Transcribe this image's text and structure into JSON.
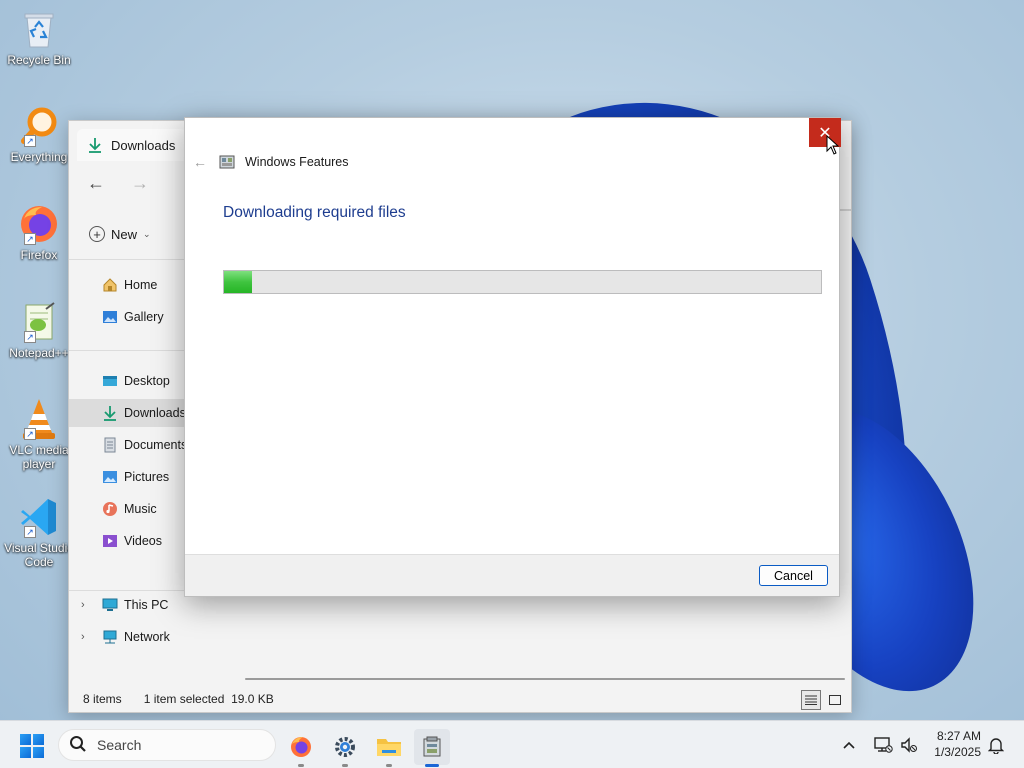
{
  "desktop": {
    "icons": [
      {
        "label": "Recycle Bin",
        "icon": "recycle-bin-icon"
      },
      {
        "label": "Everything",
        "icon": "everything-search-icon"
      },
      {
        "label": "Firefox",
        "icon": "firefox-icon"
      },
      {
        "label": "Notepad++",
        "icon": "notepad-plus-plus-icon"
      },
      {
        "label": "VLC media player",
        "icon": "vlc-icon"
      },
      {
        "label": "Visual Studio Code",
        "icon": "vscode-icon"
      }
    ]
  },
  "explorer": {
    "tab_title": "Downloads",
    "new_label": "New",
    "sidebar": [
      {
        "label": "Home",
        "icon": "home-icon"
      },
      {
        "label": "Gallery",
        "icon": "gallery-icon"
      },
      {
        "label": "Desktop",
        "icon": "desktop-folder-icon"
      },
      {
        "label": "Downloads",
        "icon": "downloads-icon",
        "selected": true
      },
      {
        "label": "Documents",
        "icon": "documents-icon"
      },
      {
        "label": "Pictures",
        "icon": "pictures-icon"
      },
      {
        "label": "Music",
        "icon": "music-icon"
      },
      {
        "label": "Videos",
        "icon": "videos-icon"
      },
      {
        "label": "This PC",
        "icon": "this-pc-icon"
      },
      {
        "label": "Network",
        "icon": "network-icon"
      }
    ],
    "status": {
      "items_count": "8 items",
      "selection": "1 item selected",
      "size": "19.0 KB"
    }
  },
  "dialog": {
    "title": "Windows Features",
    "heading": "Downloading required files",
    "progress": 0.047,
    "cancel_label": "Cancel",
    "close_symbol": "✕"
  },
  "taskbar": {
    "search_placeholder": "Search",
    "apps": [
      "firefox-icon",
      "settings-icon",
      "file-explorer-icon",
      "windows-features-icon"
    ],
    "time": "8:27 AM",
    "date": "1/3/2025"
  }
}
